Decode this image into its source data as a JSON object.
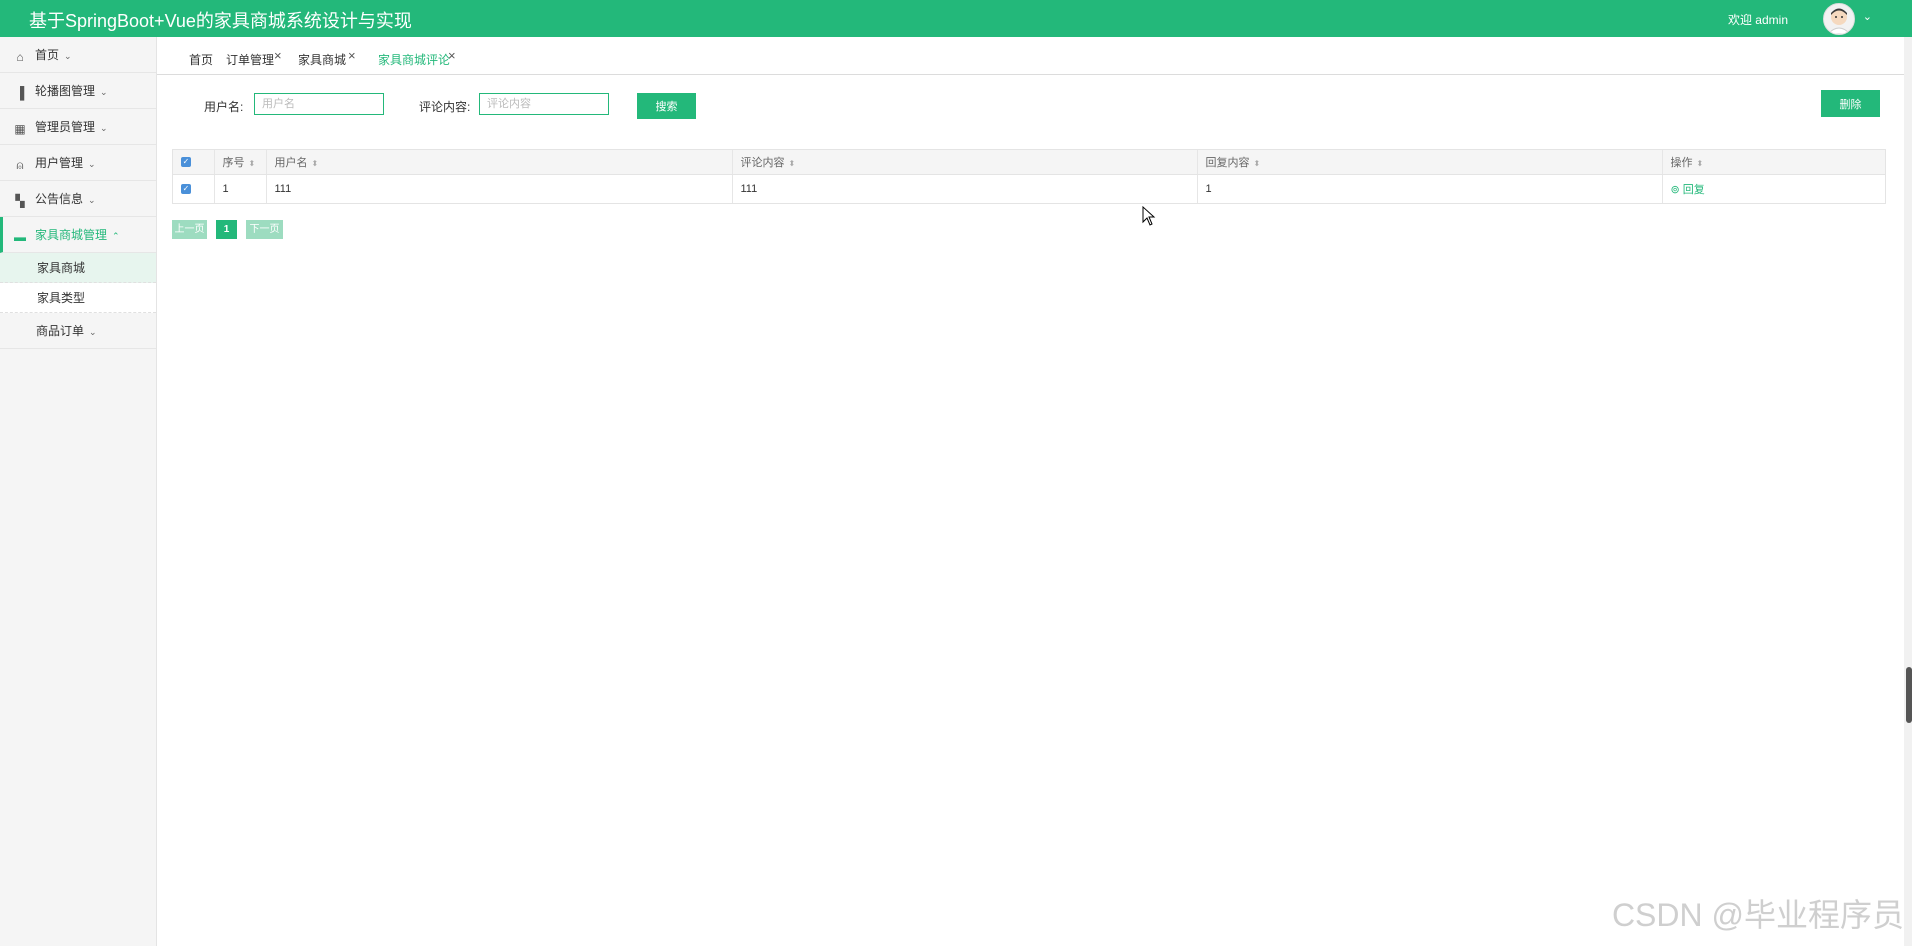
{
  "header": {
    "title": "基于SpringBoot+Vue的家具商城系统设计与实现",
    "welcome": "欢迎 admin"
  },
  "sidebar": {
    "items": [
      {
        "label": "首页",
        "icon": "home-icon"
      },
      {
        "label": "轮播图管理",
        "icon": "columns-icon"
      },
      {
        "label": "管理员管理",
        "icon": "grid-icon"
      },
      {
        "label": "用户管理",
        "icon": "user-badge-icon"
      },
      {
        "label": "公告信息",
        "icon": "dashboard-icon"
      },
      {
        "label": "家具商城管理",
        "icon": "box-icon"
      }
    ],
    "subitems": [
      {
        "label": "家具商城"
      },
      {
        "label": "家具类型"
      }
    ],
    "orders": {
      "label": "商品订单"
    }
  },
  "tabs": [
    {
      "label": "首页"
    },
    {
      "label": "订单管理"
    },
    {
      "label": "家具商城"
    },
    {
      "label": "家具商城评论"
    }
  ],
  "search": {
    "username_label": "用户名:",
    "username_placeholder": "用户名",
    "comment_label": "评论内容:",
    "comment_placeholder": "评论内容",
    "search_button": "搜索",
    "delete_button": "删除"
  },
  "table": {
    "headers": [
      "序号",
      "用户名",
      "评论内容",
      "回复内容",
      "操作"
    ],
    "rows": [
      {
        "index": "1",
        "username": "111",
        "comment": "111",
        "reply": "1",
        "action": "回复"
      }
    ]
  },
  "pagination": {
    "prev": "上一页",
    "current": "1",
    "next": "下一页"
  },
  "watermark": "CSDN @毕业程序员",
  "colors": {
    "accent": "#23b87a",
    "checkbox": "#4a90d9"
  }
}
